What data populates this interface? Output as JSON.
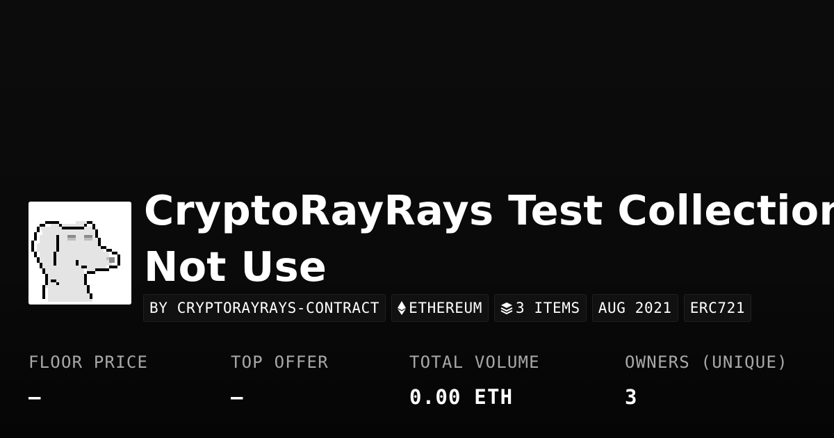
{
  "collection": {
    "title": "CryptoRayRays Test Collection - Do Not Use",
    "avatar_alt": "pixel-dog-icon"
  },
  "chips": [
    {
      "label": "BY CRYPTORAYRAYS-CONTRACT",
      "icon": ""
    },
    {
      "label": "ETHEREUM",
      "icon": "ethereum-icon"
    },
    {
      "label": "3 ITEMS",
      "icon": "layers-icon"
    },
    {
      "label": "AUG 2021",
      "icon": ""
    },
    {
      "label": "ERC721",
      "icon": ""
    }
  ],
  "stats": [
    {
      "label": "FLOOR PRICE",
      "value": "–"
    },
    {
      "label": "TOP OFFER",
      "value": "–"
    },
    {
      "label": "TOTAL VOLUME",
      "value": "0.00 ETH"
    },
    {
      "label": "OWNERS (UNIQUE)",
      "value": "3"
    }
  ],
  "colors": {
    "background": "#0a0a0a",
    "text": "#ffffff",
    "label": "#a8a8a8",
    "chip_bg": "#111111",
    "chip_border": "#202020"
  }
}
